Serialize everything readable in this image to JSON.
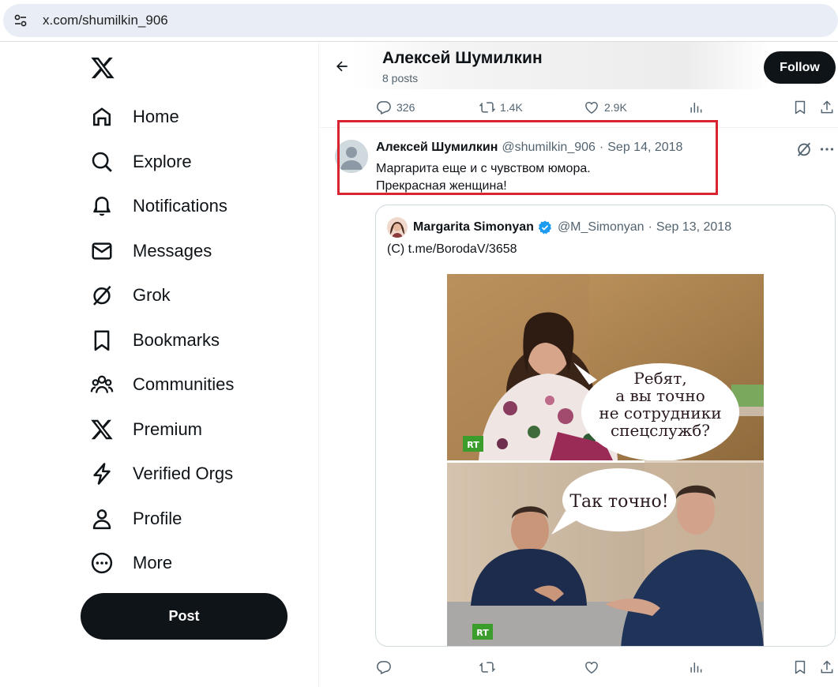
{
  "browser": {
    "url": "x.com/shumilkin_906",
    "site_icon": "tune-icon"
  },
  "sidebar": {
    "logo": "x-logo-icon",
    "items": [
      {
        "label": "Home",
        "icon": "home-icon"
      },
      {
        "label": "Explore",
        "icon": "search-icon"
      },
      {
        "label": "Notifications",
        "icon": "bell-icon"
      },
      {
        "label": "Messages",
        "icon": "envelope-icon"
      },
      {
        "label": "Grok",
        "icon": "grok-icon"
      },
      {
        "label": "Bookmarks",
        "icon": "bookmark-icon"
      },
      {
        "label": "Communities",
        "icon": "people-icon"
      },
      {
        "label": "Premium",
        "icon": "x-logo-icon"
      },
      {
        "label": "Verified Orgs",
        "icon": "lightning-icon"
      },
      {
        "label": "Profile",
        "icon": "person-icon"
      },
      {
        "label": "More",
        "icon": "more-circle-icon"
      }
    ],
    "post_label": "Post"
  },
  "header": {
    "name": "Алексей Шумилкин",
    "post_count": "8 posts",
    "follow_label": "Follow"
  },
  "top_actions": {
    "replies": "326",
    "reposts": "1.4K",
    "likes": "2.9K"
  },
  "tweet": {
    "name": "Алексей Шумилкин",
    "handle": "@shumilkin_906",
    "separator": "·",
    "date": "Sep 14, 2018",
    "line1": "Маргарита еще и с чувством юмора.",
    "line2": "Прекрасная женщина!",
    "highlight_color": "#d9232e"
  },
  "quote": {
    "name": "Margarita Simonyan",
    "handle": "@M_Simonyan",
    "separator": "·",
    "date": "Sep 13, 2018",
    "text": "(C) t.me/BorodaV/3658",
    "meme": {
      "bubble1": [
        "Ребят,",
        "а вы точно",
        "не сотрудники",
        "спецслужб?"
      ],
      "bubble2": "Так точно!",
      "logo": "RT"
    }
  },
  "colors": {
    "text": "#0f1419",
    "muted": "#536471",
    "verified": "#1d9bf0",
    "button": "#0f1419"
  }
}
